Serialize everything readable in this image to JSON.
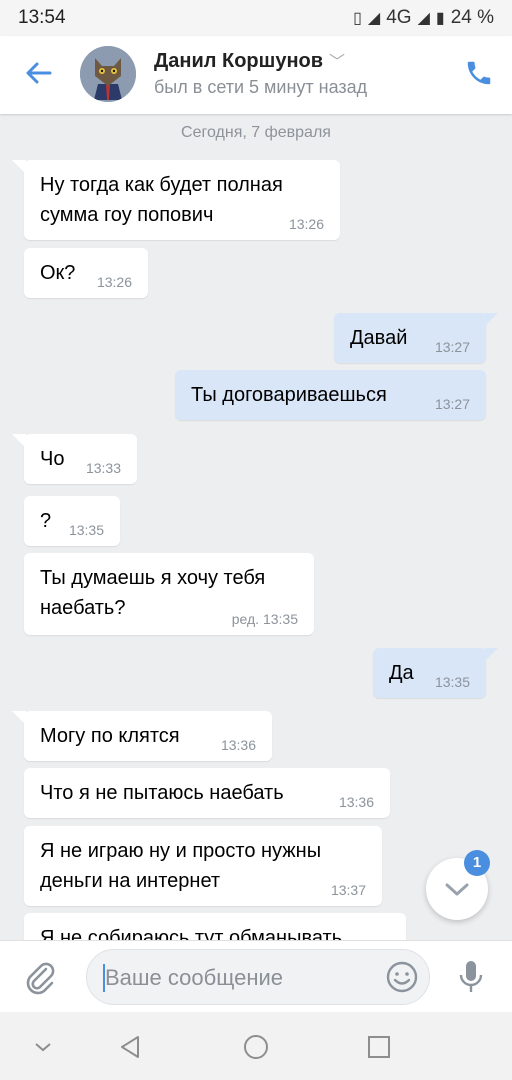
{
  "status": {
    "time": "13:54",
    "network": "4G",
    "battery": "24 %"
  },
  "header": {
    "name": "Данил Коршунов",
    "last_seen": "был в сети 5 минут назад"
  },
  "date_separator": "Сегодня, 7 февраля",
  "messages": [
    {
      "dir": "in",
      "text": "Ну тогда как будет полная сумма гоу попович",
      "time": "13:26"
    },
    {
      "dir": "in",
      "text": "Ок?",
      "time": "13:26"
    },
    {
      "dir": "out",
      "text": "Давай",
      "time": "13:27"
    },
    {
      "dir": "out",
      "text": "Ты договариваешься",
      "time": "13:27"
    },
    {
      "dir": "in",
      "text": "Чо",
      "time": "13:33"
    },
    {
      "dir": "in",
      "text": "?",
      "time": "13:35"
    },
    {
      "dir": "in",
      "text": "Ты думаешь я хочу тебя наебать?",
      "time": "ред. 13:35"
    },
    {
      "dir": "out",
      "text": "Да",
      "time": "13:35"
    },
    {
      "dir": "in",
      "text": "Могу по клятся",
      "time": "13:36"
    },
    {
      "dir": "in",
      "text": "Что я не пытаюсь наебать",
      "time": "13:36"
    },
    {
      "dir": "in",
      "text": "Я не играю ну и просто нужны деньги на интернет",
      "time": "13:37"
    },
    {
      "dir": "in",
      "text": "Я не собираюсь тут обманывать",
      "time": ""
    }
  ],
  "unread_badge": "1",
  "composer": {
    "placeholder": "Ваше сообщение"
  },
  "colors": {
    "accent": "#4a8ee0",
    "outgoing_bubble": "#d9e6f7",
    "incoming_bubble": "#ffffff",
    "background": "#edeef0"
  },
  "icons": [
    "back-arrow-icon",
    "phone-icon",
    "chevron-down-icon",
    "attach-icon",
    "emoji-icon",
    "mic-icon",
    "scroll-down-icon",
    "nav-back-icon",
    "nav-home-icon",
    "nav-recent-icon",
    "nav-collapse-icon"
  ]
}
